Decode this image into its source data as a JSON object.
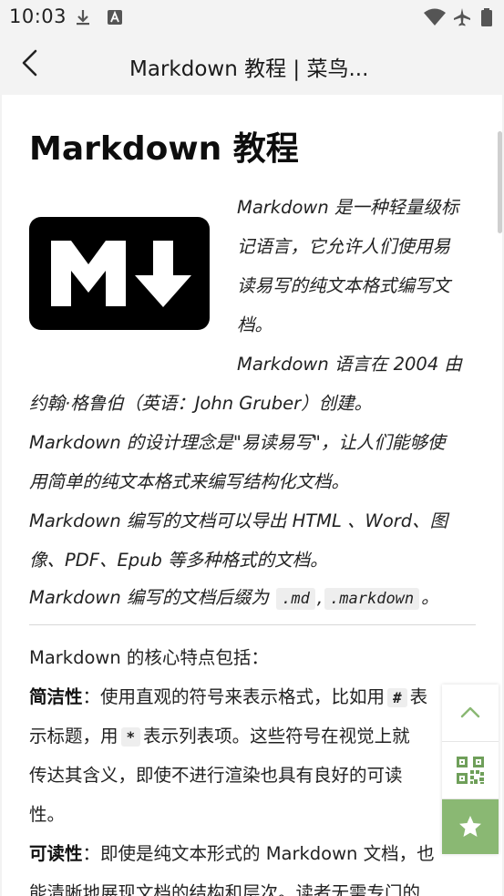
{
  "status_bar": {
    "time": "10:03",
    "icons": [
      "download-icon",
      "font-a-icon",
      "wifi-icon",
      "airplane-icon",
      "battery-icon"
    ]
  },
  "nav": {
    "back_icon": "chevron-left-icon",
    "title": "Markdown 教程 | 菜鸟..."
  },
  "article": {
    "title": "Markdown 教程",
    "logo_icon": "markdown-logo",
    "intro": {
      "line1": "Markdown 是一种轻量级标",
      "line2": "记语言，它允许人们使用易",
      "line3": "读易写的纯文本格式编写文",
      "line4": "档。",
      "line5": "Markdown 语言在 2004 由",
      "line6": "约翰·格鲁伯（英语：John Gruber）创建。",
      "line7": "Markdown 的设计理念是\"易读易写\"，让人们能够使",
      "line8": "用简单的纯文本格式来编写结构化文档。",
      "line9": "Markdown 编写的文档可以导出 HTML 、Word、图",
      "line10": "像、PDF、Epub 等多种格式的文档。",
      "line11_prefix": "Markdown 编写的文档后缀为",
      "code1": ".md",
      "sep": ",",
      "code2": ".markdown",
      "line11_suffix": "。"
    },
    "features": {
      "heading": "Markdown 的核心特点包括：",
      "f1_label": "简洁性",
      "f1_line1": "：使用直观的符号来表示格式，比如用",
      "f1_code1": "#",
      "f1_line1_tail": "表",
      "f1_line2_prefix": "示标题，用",
      "f1_code2": "*",
      "f1_line2_suffix": "表示列表项。这些符号在视觉上就",
      "f1_line3": "传达其含义，即使不进行渲染也具有良好的可读",
      "f1_line4": "性。",
      "f2_label": "可读性",
      "f2_line1": "：即使是纯文本形式的 Markdown 文档，也",
      "f2_line2": "能清晰地展现文档的结构和层次。读者无需专门的"
    }
  },
  "float_panel": {
    "top_icon": "chevron-up-icon",
    "qr_icon": "qr-code-icon",
    "fav_icon": "star-icon",
    "fav_color": "#8ab873"
  }
}
